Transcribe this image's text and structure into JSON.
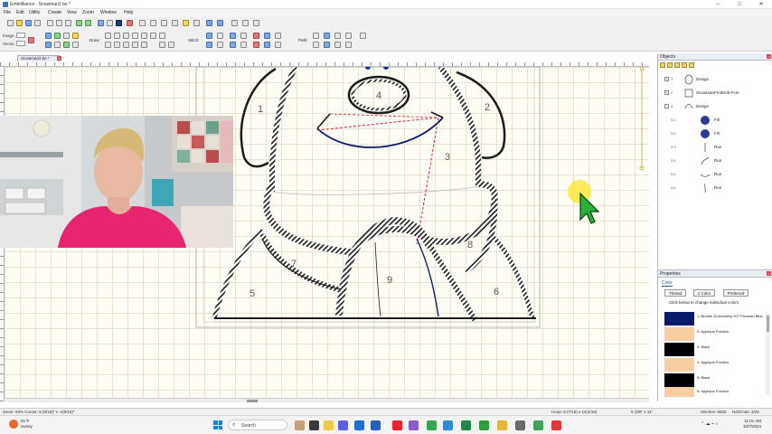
{
  "window": {
    "title": "Embrilliance - Snowman2.be *",
    "min": "–",
    "max": "□",
    "close": "✕"
  },
  "menu": [
    "File",
    "Edit",
    "Utility",
    "Create",
    "View",
    "Zoom",
    "Window",
    "Help"
  ],
  "toolbar": {
    "image_label": "Image...",
    "vector_label": "Vector...",
    "draw_label": "Draw:",
    "stitch_label": "Stitch:",
    "path_label": "Path:"
  },
  "document_tab": {
    "label": "Snowman2.be *",
    "close": "×"
  },
  "design": {
    "region_numbers": [
      "1",
      "2",
      "3",
      "4",
      "5",
      "6",
      "7",
      "8",
      "9"
    ]
  },
  "status": {
    "zoom_cursor": "Zoom: 93%  Cursor: 6 (5/16)\" x -1(9/16)\"",
    "hoop": "Hoop: 9 (7/16) x 14(3/16)",
    "hoop_size": "9 (3/8\" x 11\"",
    "stitches": "Stitches: 5825",
    "needs_cuts": "Nds/Cuts: 3/25"
  },
  "objects_panel": {
    "title": "Objects",
    "close": "×",
    "items": [
      {
        "index": "1",
        "expander": "+",
        "name": "Design",
        "level": 0
      },
      {
        "index": "2",
        "expander": "+",
        "name": "SnowmanFrmEmb-Fcm",
        "level": 0
      },
      {
        "index": "3",
        "expander": "−",
        "name": "Design",
        "level": 0
      },
      {
        "index": "3.1",
        "expander": "",
        "name": "Fill",
        "level": 1
      },
      {
        "index": "3.2",
        "expander": "",
        "name": "Fill",
        "level": 1
      },
      {
        "index": "3.3",
        "expander": "",
        "name": "Run",
        "level": 1
      },
      {
        "index": "3.4",
        "expander": "",
        "name": "Run",
        "level": 1
      },
      {
        "index": "3.5",
        "expander": "",
        "name": "Run",
        "level": 1
      },
      {
        "index": "3.6",
        "expander": "",
        "name": "Run",
        "level": 1
      }
    ]
  },
  "properties_panel": {
    "title": "Properties",
    "close": "×",
    "tab": "Color",
    "buttons": [
      "Thread",
      "1 Color",
      "Preferred"
    ],
    "hint": "Click below to change individual colors",
    "colors": [
      {
        "label": "1: Brother Embroidery 007 Prussian Blue",
        "swatch": "#0a1a6b"
      },
      {
        "label": "2: Applique Position",
        "swatch": "#f7cfa0"
      },
      {
        "label": "3: Black",
        "swatch": "#000000"
      },
      {
        "label": "4: Applique Position",
        "swatch": "#f7cfa0"
      },
      {
        "label": "5: Black",
        "swatch": "#000000"
      },
      {
        "label": "6: Applique Position",
        "swatch": "#f7cfa0"
      }
    ]
  },
  "taskbar": {
    "weather_temp": "61°F",
    "weather_desc": "Sunny",
    "search_placeholder": "Search",
    "time": "11:01 AM",
    "date": "10/7/2024"
  },
  "colors": {
    "accent": "#2a5aa8",
    "canvas": "#fffdf4",
    "grid": "#e6e3d3",
    "stitch_black": "#1a1a1a",
    "stitch_navy": "#0a1a6b",
    "guide_red": "#e0203a",
    "cursor_green": "#27b23a",
    "cursor_highlight": "#ffe628"
  }
}
